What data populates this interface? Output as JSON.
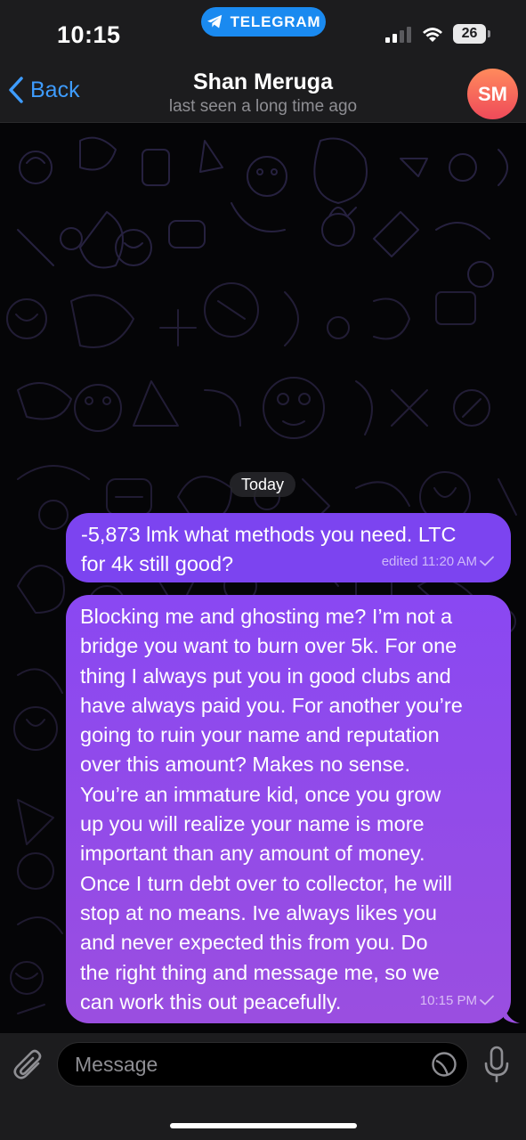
{
  "status_bar": {
    "time": "10:15",
    "app_pill": "TELEGRAM",
    "battery": "26"
  },
  "header": {
    "back_label": "Back",
    "contact_name": "Shan Meruga",
    "contact_status": "last seen a long time ago",
    "avatar_initials": "SM"
  },
  "chat": {
    "date_divider": "Today",
    "messages": [
      {
        "text": "-5,873 lmk what methods you need. LTC\nfor 4k still good?",
        "meta": "edited 11:20 AM",
        "status": "sent-check-icon"
      },
      {
        "text": "Blocking me and ghosting me? I’m not a\nbridge you want to burn over 5k. For one\nthing I always put you in good clubs and\nhave always paid you. For another you’re\ngoing to ruin your name and reputation\nover this amount? Makes no sense.\nYou’re an immature kid, once you grow\nup you will realize your name is more\nimportant than any amount of money.\nOnce I turn debt over to collector, he will\nstop at no means. Ive always likes you\nand never expected this from you. Do\nthe right thing and message me, so we\ncan work this out peacefully.",
        "meta": "10:15 PM",
        "status": "sent-check-icon"
      }
    ]
  },
  "input": {
    "placeholder": "Message",
    "value": ""
  },
  "colors": {
    "bubble": "#8a48f2",
    "accent": "#3e9cff",
    "telegram_pill": "#1a8af0",
    "avatar_top": "#ff8a5c",
    "avatar_bottom": "#ef4a5a"
  }
}
